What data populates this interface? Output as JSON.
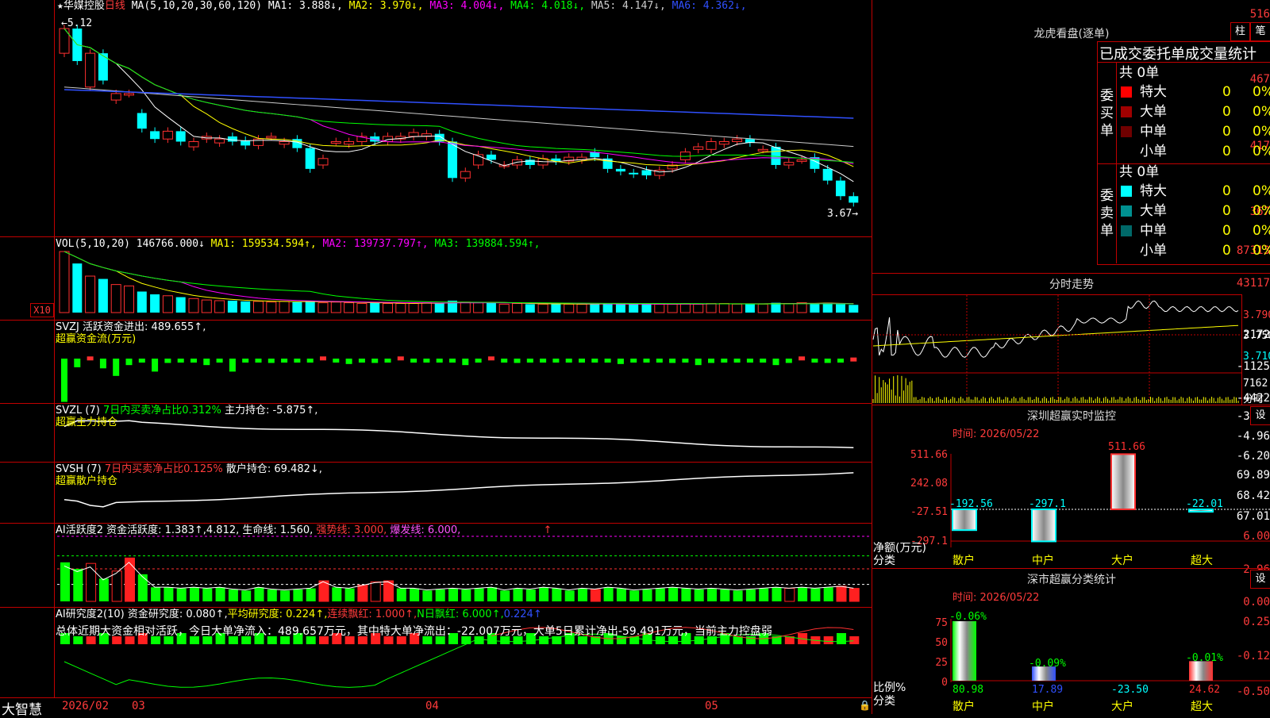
{
  "stock": {
    "name": "华媒控股",
    "period": "日线"
  },
  "price_panel": {
    "ma_params": "MA(5,10,20,30,60,120)",
    "ma": [
      {
        "label": "MA1: 3.888↓",
        "color": "#ffffff"
      },
      {
        "label": "MA2: 3.970↓",
        "color": "#ffff00"
      },
      {
        "label": "MA3: 4.004↓",
        "color": "#ff00ff"
      },
      {
        "label": "MA4: 4.018↓",
        "color": "#00ff00"
      },
      {
        "label": "MA5: 4.147↓",
        "color": "#cccccc"
      },
      {
        "label": "MA6: 4.362↓",
        "color": "#3050ff"
      }
    ],
    "y_labels": [
      "516",
      "467",
      "417",
      "367"
    ],
    "high_marker": "5.12",
    "low_marker": "3.67→"
  },
  "vol_panel": {
    "title": "VOL(5,10,20)",
    "value": "146766.000↓",
    "ma": [
      {
        "label": "MA1: 159534.594↑",
        "color": "#ffff00"
      },
      {
        "label": "MA2: 139737.797↑",
        "color": "#ff00ff"
      },
      {
        "label": "MA3: 139884.594↑",
        "color": "#00ff00"
      }
    ],
    "y_labels": [
      "87313",
      "43117"
    ],
    "unit": "X10"
  },
  "svzj_panel": {
    "title": "SVZJ",
    "text": "活跃资金进出: 489.655↑,",
    "sub": "超赢资金流(万元)",
    "y_labels": [
      "2172",
      "-1125",
      "-4422"
    ]
  },
  "svzl_panel": {
    "title": "SVZL (7)",
    "pct": "7日内买卖净占比0.312%",
    "text": "主力持仓: -5.875↑,",
    "sub": "超赢主力持仓",
    "y_labels": [
      "-3.71",
      "-4.96",
      "-6.20"
    ]
  },
  "svsh_panel": {
    "title": "SVSH (7)",
    "pct": "7日内买卖净占比0.125%",
    "text": "散户持仓: 69.482↓,",
    "sub": "超赢散户持仓",
    "y_labels": [
      "69.89",
      "68.42",
      "67.01"
    ]
  },
  "ai_active_panel": {
    "title": "AI活跃度2",
    "text": "资金活跃度: 1.383↑,4.812,",
    "life": "生命线: 1.560,",
    "strong": "强势线: 3.000,",
    "burst": "爆发线: 6.000,",
    "arrow": "↑",
    "y_labels": [
      "6.00",
      "2.96",
      "0.00"
    ]
  },
  "ai_research_panel": {
    "title": "AI研究度2(10)",
    "text": "资金研究度: 0.080↑,",
    "avg": "平均研究度: 0.224↑,",
    "streak": "连续飘红: 1.000↑,",
    "nred": "N日飘红: 6.000↑,",
    "last": "0.224↑",
    "summary": "总体近期大资金相对活跃，今日大单净流入：489.657万元，其中特大单净流出：-22.007万元，大单5日累计净出-59.491万元，当前主力控盘弱",
    "y_labels": [
      "0.25",
      "-0.12",
      "-0.50"
    ]
  },
  "bottom_bar": {
    "brand": "大智慧",
    "dates": [
      "2026/02",
      "03",
      "04",
      "05"
    ]
  },
  "dragon_tiger": {
    "title": "龙虎看盘(逐单)",
    "btn_bar": "柱",
    "btn_pen": "笔",
    "header": "已成交委托单成交量统计",
    "buy": {
      "label": "委买单",
      "total": "共 0单",
      "rows": [
        {
          "name": "特大",
          "count": "0",
          "pct": "0%",
          "color": "#ff0000"
        },
        {
          "name": "大单",
          "count": "0",
          "pct": "0%",
          "color": "#a00000"
        },
        {
          "name": "中单",
          "count": "0",
          "pct": "0%",
          "color": "#700000"
        },
        {
          "name": "小单",
          "count": "0",
          "pct": "0%",
          "color": ""
        }
      ]
    },
    "sell": {
      "label": "委卖单",
      "total": "共 0单",
      "rows": [
        {
          "name": "特大",
          "count": "0",
          "pct": "0%",
          "color": "#00ffff"
        },
        {
          "name": "大单",
          "count": "0",
          "pct": "0%",
          "color": "#009090"
        },
        {
          "name": "中单",
          "count": "0",
          "pct": "0%",
          "color": "#006868"
        },
        {
          "name": "小单",
          "count": "0",
          "pct": "0%",
          "color": ""
        }
      ]
    }
  },
  "intraday": {
    "title": "分时走势",
    "y_labels": [
      "3.790",
      "3.750",
      "3.710"
    ],
    "vol_label": "7162",
    "vol_unit": "分时"
  },
  "monitor": {
    "title": "深圳超赢实时监控",
    "btn": "设",
    "time": "时间: 2026/05/22",
    "y_labels": [
      "511.66",
      "242.08",
      "-27.51",
      "-297.1"
    ],
    "unit": "净额(万元)",
    "cat_label": "分类",
    "categories": [
      "散户",
      "中户",
      "大户",
      "超大"
    ],
    "values": [
      "-192.56",
      "-297.1",
      "511.66",
      "-22.01"
    ]
  },
  "classify": {
    "title": "深市超赢分类统计",
    "btn": "设",
    "time": "时间: 2026/05/22",
    "y_labels": [
      "75",
      "50",
      "25",
      "0"
    ],
    "unit": "比例%",
    "cat_label": "分类",
    "categories": [
      "散户",
      "中户",
      "大户",
      "超大"
    ],
    "pct_top": [
      "-0.06%",
      "-0.09%",
      "",
      "-0.01%"
    ],
    "values": [
      "80.98",
      "17.89",
      "-23.50",
      "24.62"
    ]
  }
}
